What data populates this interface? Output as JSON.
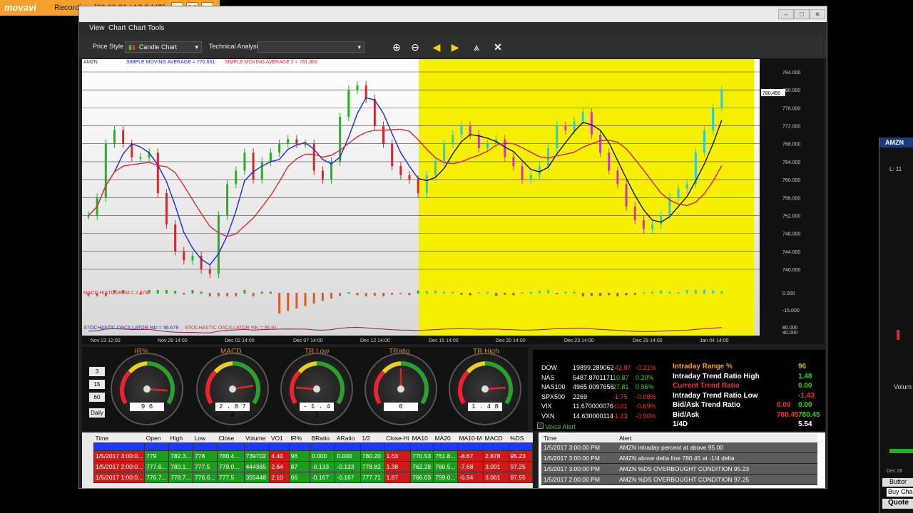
{
  "recorder": {
    "logo": "movavi",
    "status": "Recording",
    "time": "[00:00:31 / 16.8 MB]"
  },
  "menu": [
    "View",
    "Chart",
    "Chart Tools"
  ],
  "toolbar": {
    "price_style_label": "Price Style",
    "price_style_value": "Candle Chart",
    "technical_label": "Technical Analysis"
  },
  "chart": {
    "symbol": "AMZN",
    "legend_ohlc": "780.450",
    "sma1": "SIMPLE MOVING AVERAGE = 770.631",
    "sma2": "SIMPLE MOVING AVERAGE 2 = 761.866",
    "macd_label": "MACD HISTOGRAM = 2.878",
    "stoch_label": "STOCHASTIC OSCILLATOR %D = 96.679",
    "stoch_label2": "STOCHASTIC OSCILLATOR %K = 95.91",
    "last_price": "780.450",
    "price_ticks": [
      "784.000",
      "780.000",
      "776.000",
      "772.000",
      "768.000",
      "764.000",
      "760.000",
      "756.000",
      "752.000",
      "748.000",
      "744.000",
      "740.000"
    ],
    "macd_ticks": [
      "0.000",
      "-15.000"
    ],
    "stoch_ticks": [
      "80.000",
      "40.000"
    ],
    "date_ticks": [
      "Nov 23 12:00",
      "Nov 29 14:00",
      "Dec 02 14:00",
      "Dec 07 14:00",
      "Dec 12 14:00",
      "Dec 15 14:00",
      "Dec 20 14:00",
      "Dec 23 14:00",
      "Dec 29 14:00",
      "Jan 04 14:00"
    ],
    "colors": {
      "up": "#1fb31f",
      "down": "#d22a2a",
      "sma1": "#1a2bd6",
      "sma2": "#e02c2c",
      "highlight": "#f5f000",
      "up2": "#28c8e8",
      "down2": "#d030d0"
    }
  },
  "chart_data": {
    "type": "candlestick",
    "ylim": [
      740,
      784
    ],
    "close_path": [
      752,
      756,
      768,
      771,
      768,
      765,
      765,
      766,
      757,
      750,
      744,
      742,
      743,
      740,
      739,
      752,
      759,
      762,
      766,
      760,
      764,
      766,
      768,
      769,
      768,
      768,
      762,
      760,
      764,
      774,
      780,
      781,
      778,
      772,
      768,
      763,
      761,
      760,
      757,
      761,
      764,
      768,
      770,
      772,
      770,
      767,
      768,
      769,
      765,
      763,
      760,
      761,
      763,
      767,
      772,
      771,
      773,
      775,
      770,
      766,
      762,
      759,
      754,
      751,
      749,
      750,
      752,
      756,
      758,
      759,
      766,
      771,
      776,
      780
    ]
  },
  "gauges": {
    "side_buttons": [
      "3",
      "15",
      "60",
      "Daily"
    ],
    "items": [
      {
        "title": "IR%",
        "value": "9 6",
        "needle": 0.85
      },
      {
        "title": "MACD",
        "value": "2 . 8 7 8",
        "needle": 0.8
      },
      {
        "title": "TR Low",
        "value": "- 1 . 4 3",
        "needle": 0.18
      },
      {
        "title": "TRatio",
        "value": "0",
        "needle": 0.5
      },
      {
        "title": "TR High",
        "value": "1 . 4 8",
        "needle": 0.82
      }
    ]
  },
  "market": {
    "rows": [
      {
        "sym": "DOW",
        "val": "19899.289062",
        "chg": "-42.87",
        "pct": "-0.21%"
      },
      {
        "sym": "NAS",
        "val": "5487.8701171",
        "chg": "10.87",
        "pct": "0.20%"
      },
      {
        "sym": "NAS100",
        "val": "4965.0097656",
        "chg": "27.81",
        "pct": "0.56%"
      },
      {
        "sym": "SPX500",
        "val": "2269",
        "chg": "-1.75",
        "pct": "-0.08%"
      },
      {
        "sym": "VIX",
        "val": "11.670000076",
        "chg": "-0.01",
        "pct": "-0.69%"
      },
      {
        "sym": "VXN",
        "val": "14.630000114",
        "chg": "-1.43",
        "pct": "-0.90%"
      }
    ],
    "voice_alert": "Voice Alert",
    "stats": [
      {
        "label": "Intraday Range %",
        "value": "96",
        "value2": ""
      },
      {
        "label": "Intraday Trend Ratio High",
        "value": "1.48",
        "value2": ""
      },
      {
        "label": "Current Trend Ratio",
        "value": "0.00",
        "value2": ""
      },
      {
        "label": "Intraday Trend Ratio Low",
        "value": "-1.43",
        "value2": ""
      },
      {
        "label": "Bid/Ask Trend Ratio",
        "value": "0.00",
        "value2": "0.00"
      },
      {
        "label": "Bid/Ask",
        "value": "780.45",
        "value2": "780.45"
      },
      {
        "label": "1/4D",
        "value": "5.54",
        "value2": ""
      }
    ]
  },
  "grid": {
    "headers": [
      "Time",
      "Open",
      "High",
      "Low",
      "Close",
      "Volume",
      "VO1",
      "IR%",
      "BRatio",
      "ARatio",
      "1/2",
      "Close-Hi",
      "MA10",
      "MA20",
      "MA10-M",
      "MACD",
      "%DS"
    ],
    "rows": [
      [
        "1/5/2017 3:00:0...",
        "779",
        "782.3...",
        "778",
        "780.4...",
        "739702",
        "4.40",
        "96",
        "0.000",
        "0.000",
        "780.20",
        "1.63",
        "770.53",
        "761.8...",
        "-8.67",
        "2.878",
        "95.23"
      ],
      [
        "1/5/2017 2:00:0...",
        "777.6...",
        "780.1...",
        "777.5",
        "779.0...",
        "444365",
        "2.64",
        "87",
        "-0.133",
        "-0.133",
        "778.82",
        "1.38",
        "762.28",
        "760.5...",
        "-7.68",
        "3.001",
        "97.25"
      ],
      [
        "1/5/2017 1:00:0...",
        "776.7...",
        "778.7...",
        "776.6...",
        "777.5",
        "355448",
        "2.10",
        "66",
        "-0.167",
        "-0.167",
        "777.71",
        "1.87",
        "766.03",
        "759.0...",
        "-6.94",
        "3.061",
        "97.55"
      ]
    ]
  },
  "alerts": {
    "headers": [
      "Time",
      "Alert"
    ],
    "rows": [
      [
        "1/5/2017 3:00:00 PM",
        "AMZN intraday percent at above 95.00"
      ],
      [
        "1/5/2017 3:00:00 PM",
        "AMZN above delta line 780.45 at -1/4 delta"
      ],
      [
        "1/5/2017 3:00:00 PM",
        "AMZN %DS OVERBOUGHT CONDITION 95.23"
      ],
      [
        "1/5/2017 2:00:00 PM",
        "AMZN %DS OVERBOUGHT CONDITION 97.25"
      ]
    ]
  },
  "rightwin": {
    "title": "AMZN",
    "label1": "L: 11",
    "label2": "Volum",
    "label3": "Dec 26",
    "label4": "Buttor",
    "label5": "Buy Cha",
    "label6": "Quote"
  }
}
